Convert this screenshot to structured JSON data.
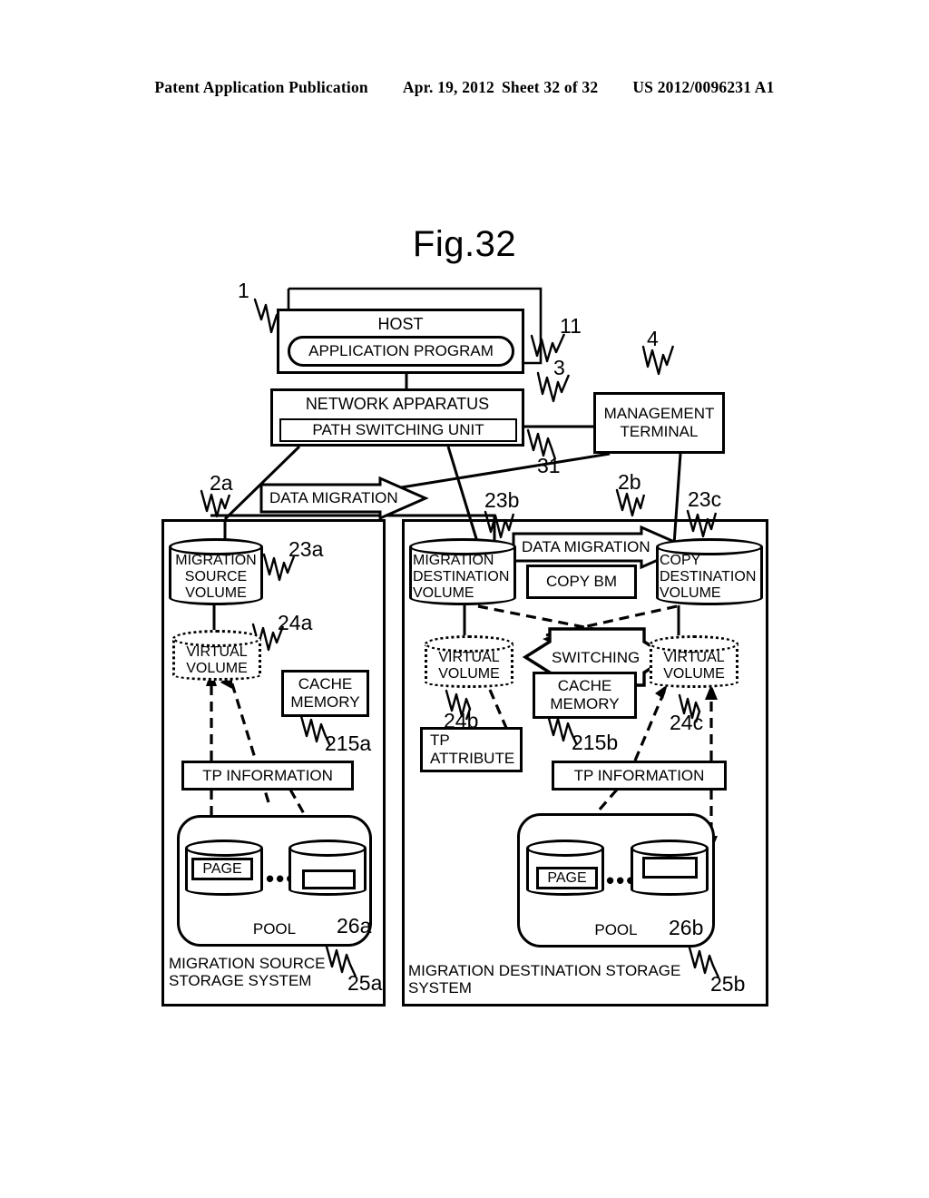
{
  "header": {
    "left": "Patent Application Publication",
    "date": "Apr. 19, 2012",
    "sheet": "Sheet 32 of 32",
    "docnum": "US 2012/0096231 A1"
  },
  "figure": {
    "title": "Fig.32"
  },
  "nodes": {
    "host": "HOST",
    "application_program": "APPLICATION PROGRAM",
    "network_apparatus": "NETWORK APPARATUS",
    "path_switching_unit": "PATH SWITCHING UNIT",
    "management_terminal": "MANAGEMENT\nTERMINAL",
    "data_migration_1": "DATA MIGRATION",
    "data_migration_2": "DATA MIGRATION",
    "migration_source_volume": "MIGRATION\nSOURCE\nVOLUME",
    "migration_destination_volume": "MIGRATION\nDESTINATION\nVOLUME",
    "copy_destination_volume": "COPY\nDESTINATION\nVOLUME",
    "copy_bm": "COPY BM",
    "virtual_volume_a": "VIRTUAL\nVOLUME",
    "virtual_volume_b": "VIRTUAL\nVOLUME",
    "virtual_volume_c": "VIRTUAL\nVOLUME",
    "switching": "SWITCHING",
    "cache_memory_a": "CACHE\nMEMORY",
    "cache_memory_b": "CACHE\nMEMORY",
    "tp_attribute": "TP\nATTRIBUTE",
    "tp_information_a": "TP INFORMATION",
    "tp_information_b": "TP INFORMATION",
    "page_a": "PAGE",
    "page_b": "PAGE",
    "pool_a": "POOL",
    "pool_b": "POOL",
    "dots_a": "•••",
    "dots_b": "•••",
    "migration_source_storage_system": "MIGRATION SOURCE\nSTORAGE SYSTEM",
    "migration_destination_storage_system": "MIGRATION DESTINATION STORAGE\nSYSTEM"
  },
  "reference_numerals": {
    "host": "1",
    "application_program": "11",
    "network_apparatus": "3",
    "path_switching_unit": "31",
    "management_terminal": "4",
    "storage_system_a": "2a",
    "storage_system_b": "2b",
    "migration_source_volume": "23a",
    "migration_destination_volume": "23b",
    "copy_destination_volume": "23c",
    "virtual_volume_a": "24a",
    "virtual_volume_b": "24b",
    "virtual_volume_c": "24c",
    "cache_memory_a": "215a",
    "cache_memory_b": "215b",
    "pool_a": "25a",
    "pool_b": "25b",
    "pool_disk_a": "26a",
    "pool_disk_b": "26b"
  }
}
